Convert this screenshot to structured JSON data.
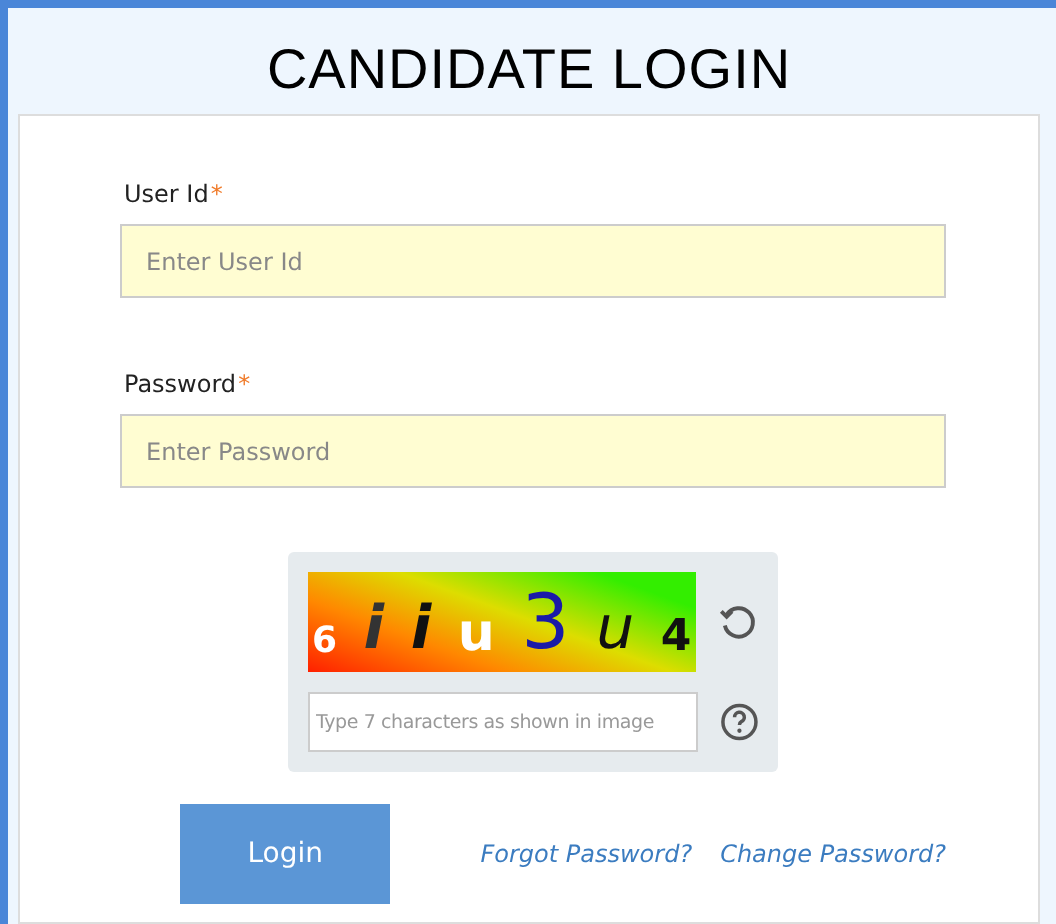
{
  "title": "CANDIDATE LOGIN",
  "fields": [
    {
      "label": "User Id",
      "required_mark": "*",
      "placeholder": "Enter User Id"
    },
    {
      "label": "Password",
      "required_mark": "*",
      "placeholder": "Enter Password"
    }
  ],
  "captcha": {
    "characters": [
      {
        "char": "6",
        "color": "#ffffff"
      },
      {
        "char": "i",
        "color": "#333333"
      },
      {
        "char": "i",
        "color": "#111111"
      },
      {
        "char": "u",
        "color": "#ffffff"
      },
      {
        "char": "3",
        "color": "#1a1aa8"
      },
      {
        "char": "u",
        "color": "#111111"
      },
      {
        "char": "4",
        "color": "#111111"
      }
    ],
    "placeholder": "Type 7 characters as shown in image"
  },
  "login_button": "Login",
  "links": [
    "Forgot Password?",
    "Change Password?"
  ]
}
